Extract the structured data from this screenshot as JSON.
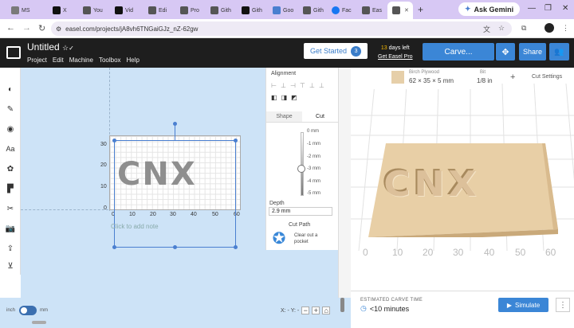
{
  "browser": {
    "tabs": [
      {
        "label": "MS",
        "color": "#7a7a7a"
      },
      {
        "label": "X",
        "color": "#111111"
      },
      {
        "label": "You",
        "color": "#555555"
      },
      {
        "label": "Vid",
        "color": "#111111"
      },
      {
        "label": "Edi",
        "color": "#555555"
      },
      {
        "label": "Pro",
        "color": "#555555"
      },
      {
        "label": "Gith",
        "color": "#555555"
      },
      {
        "label": "Gith",
        "color": "#111111"
      },
      {
        "label": "Goo",
        "color": "#4a7fd0"
      },
      {
        "label": "Gith",
        "color": "#555555"
      },
      {
        "label": "Fac",
        "color": "#1877f2"
      },
      {
        "label": "Eas",
        "color": "#555555"
      },
      {
        "label": "",
        "color": "#555555"
      }
    ],
    "gemini_label": "Ask Gemini",
    "url": "easel.com/projects/jA8vh6TNGaiGJz_nZ-62gw"
  },
  "header": {
    "title": "Untitled",
    "menu": [
      "Project",
      "Edit",
      "Machine",
      "Toolbox",
      "Help"
    ],
    "get_started_label": "Get Started",
    "get_started_count": "3",
    "trial_days": "13",
    "trial_text": "days left",
    "trial_link": "Get Easel Pro",
    "carve_label": "Carve...",
    "share_label": "Share"
  },
  "canvas": {
    "y_ticks": [
      "30",
      "20",
      "10",
      "0"
    ],
    "x_ticks": [
      "0",
      "10",
      "20",
      "30",
      "40",
      "50",
      "60"
    ],
    "design_text": "CNX",
    "note_placeholder": "Click to add note",
    "unit_left": "inch",
    "unit_right": "mm",
    "coord_label": "X: - Y: -"
  },
  "panel": {
    "alignment_label": "Alignment",
    "tabs": [
      "Shape",
      "Cut"
    ],
    "depth_marks": [
      "0 mm",
      "-1 mm",
      "-2 mm",
      "-3 mm",
      "-4 mm",
      "-5 mm"
    ],
    "depth_label": "Depth",
    "depth_value": "2.9 mm",
    "cut_path_label": "Cut Path",
    "cut_path_desc": "Clear out a pocket"
  },
  "preview": {
    "material_label": "Birch Plywood",
    "material_size": "62 × 35 × 5 mm",
    "bit_label": "Bit",
    "bit_value": "1/8 in",
    "cut_settings_label": "Cut Settings",
    "axis_ticks": [
      "0",
      "10",
      "20",
      "30",
      "40",
      "50",
      "60"
    ],
    "carved_text": "CNX"
  },
  "footer": {
    "estimated_label": "ESTIMATED CARVE TIME",
    "estimated_value": "<10 minutes",
    "simulate_label": "Simulate"
  },
  "colors": {
    "accent": "#3b86d6",
    "canvas_bg": "#cde3f7",
    "wood": "#e6cfa9",
    "header_bg": "#1e1e1e"
  }
}
